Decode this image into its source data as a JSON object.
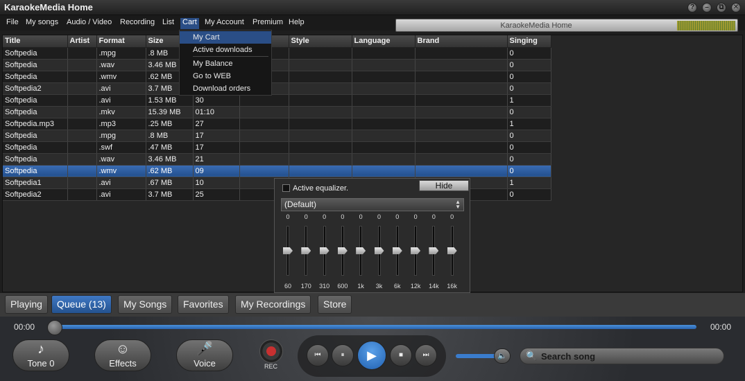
{
  "window": {
    "title": "KaraokeMedia Home",
    "buttons": [
      "?",
      "–",
      "⧉",
      "✕"
    ]
  },
  "menu": [
    "File",
    "My songs",
    "Audio / Video",
    "Recording",
    "List",
    "Cart",
    "My Account",
    "Premium",
    "Help"
  ],
  "display": {
    "text": "KaraokeMedia Home"
  },
  "cart_menu": [
    "My Cart",
    "Active downloads",
    "My Balance",
    "Go to WEB",
    "Download orders"
  ],
  "table": {
    "columns": [
      "Title",
      "Artist",
      "Format",
      "Size",
      "",
      "",
      "Style",
      "Language",
      "Brand",
      "Singing"
    ],
    "rows": [
      [
        "Softpedia",
        "",
        ".mpg",
        ".8 MB",
        "",
        "",
        "",
        "",
        "",
        "0"
      ],
      [
        "Softpedia",
        "",
        ".wav",
        "3.46 MB",
        "",
        "",
        "",
        "",
        "",
        "0"
      ],
      [
        "Softpedia",
        "",
        ".wmv",
        ".62 MB",
        "",
        "",
        "",
        "",
        "",
        "0"
      ],
      [
        "Softpedia2",
        "",
        ".avi",
        "3.7 MB",
        "",
        "",
        "",
        "",
        "",
        "0"
      ],
      [
        "Softpedia",
        "",
        ".avi",
        "1.53 MB",
        "30",
        "",
        "",
        "",
        "",
        "1"
      ],
      [
        "Softpedia",
        "",
        ".mkv",
        "15.39 MB",
        "01:10",
        "",
        "",
        "",
        "",
        "0"
      ],
      [
        "Softpedia.mp3",
        "",
        ".mp3",
        ".25 MB",
        "27",
        "",
        "",
        "",
        "",
        "1"
      ],
      [
        "Softpedia",
        "",
        ".mpg",
        ".8 MB",
        "17",
        "",
        "",
        "",
        "",
        "0"
      ],
      [
        "Softpedia",
        "",
        ".swf",
        ".47 MB",
        "17",
        "",
        "",
        "",
        "",
        "0"
      ],
      [
        "Softpedia",
        "",
        ".wav",
        "3.46 MB",
        "21",
        "",
        "",
        "",
        "",
        "0"
      ],
      [
        "Softpedia",
        "",
        ".wmv",
        ".62 MB",
        "09",
        "",
        "",
        "",
        "",
        "0"
      ],
      [
        "Softpedia1",
        "",
        ".avi",
        ".67 MB",
        "10",
        "",
        "",
        "",
        "",
        "1"
      ],
      [
        "Softpedia2",
        "",
        ".avi",
        "3.7 MB",
        "25",
        "",
        "",
        "",
        "",
        "0"
      ]
    ]
  },
  "equalizer": {
    "label": "Active equalizer.",
    "hide_label": "Hide",
    "preset": "(Default)",
    "bands": [
      {
        "freq": "60",
        "value": "0"
      },
      {
        "freq": "170",
        "value": "0"
      },
      {
        "freq": "310",
        "value": "0"
      },
      {
        "freq": "600",
        "value": "0"
      },
      {
        "freq": "1k",
        "value": "0"
      },
      {
        "freq": "3k",
        "value": "0"
      },
      {
        "freq": "6k",
        "value": "0"
      },
      {
        "freq": "12k",
        "value": "0"
      },
      {
        "freq": "14k",
        "value": "0"
      },
      {
        "freq": "16k",
        "value": "0"
      }
    ]
  },
  "tabs": [
    "Playing",
    "Queue (13)",
    "My Songs",
    "Favorites",
    "My Recordings",
    "Store"
  ],
  "player": {
    "time_start": "00:00",
    "time_end": "00:00",
    "tone_label": "Tone 0",
    "effects_label": "Effects",
    "voice_label": "Voice",
    "rec_label": "REC",
    "search_placeholder": "Search song"
  },
  "colors": {
    "accent": "#2a64b0",
    "selected_row": "#2e5fa3",
    "rec": "#c83030"
  }
}
